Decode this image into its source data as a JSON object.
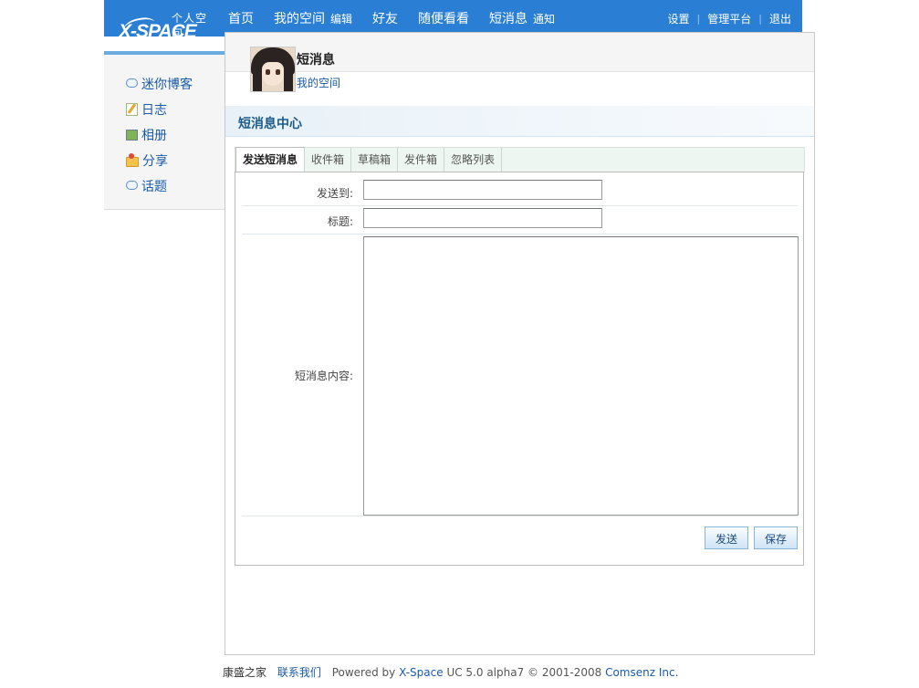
{
  "logo": {
    "cn": "个人空间",
    "en": "X-SPACE"
  },
  "nav": {
    "home": "首页",
    "my_space": "我的空间",
    "edit": "编辑",
    "friends": "好友",
    "browse": "随便看看",
    "messages": "短消息",
    "notices": "通知",
    "settings": "设置",
    "admin": "管理平台",
    "logout": "退出"
  },
  "sidebar": {
    "items": [
      {
        "label": "迷你博客",
        "icon": "speech-bubble-icon"
      },
      {
        "label": "日志",
        "icon": "notepad-icon"
      },
      {
        "label": "相册",
        "icon": "photo-icon"
      },
      {
        "label": "分享",
        "icon": "folder-share-icon"
      },
      {
        "label": "话题",
        "icon": "speech-bubble-icon"
      }
    ]
  },
  "profile": {
    "title": "短消息",
    "link": "我的空间"
  },
  "section": {
    "title": "短消息中心"
  },
  "tabs": [
    {
      "label": "发送短消息",
      "active": true
    },
    {
      "label": "收件箱",
      "active": false
    },
    {
      "label": "草稿箱",
      "active": false
    },
    {
      "label": "发件箱",
      "active": false
    },
    {
      "label": "忽略列表",
      "active": false
    }
  ],
  "form": {
    "to_label": "发送到:",
    "to_value": "",
    "subject_label": "标题:",
    "subject_value": "",
    "content_label": "短消息内容:",
    "content_value": "",
    "send_button": "发送",
    "save_button": "保存"
  },
  "footer": {
    "site_name": "康盛之家",
    "contact": "联系我们",
    "powered_prefix": "Powered by",
    "product_link": "X-Space",
    "version": "UC 5.0 alpha7 © 2001-2008",
    "company": "Comsenz Inc."
  },
  "colors": {
    "topbar": "#2a7fd4",
    "link": "#1a5aa8",
    "section_title": "#1d5b8a"
  }
}
